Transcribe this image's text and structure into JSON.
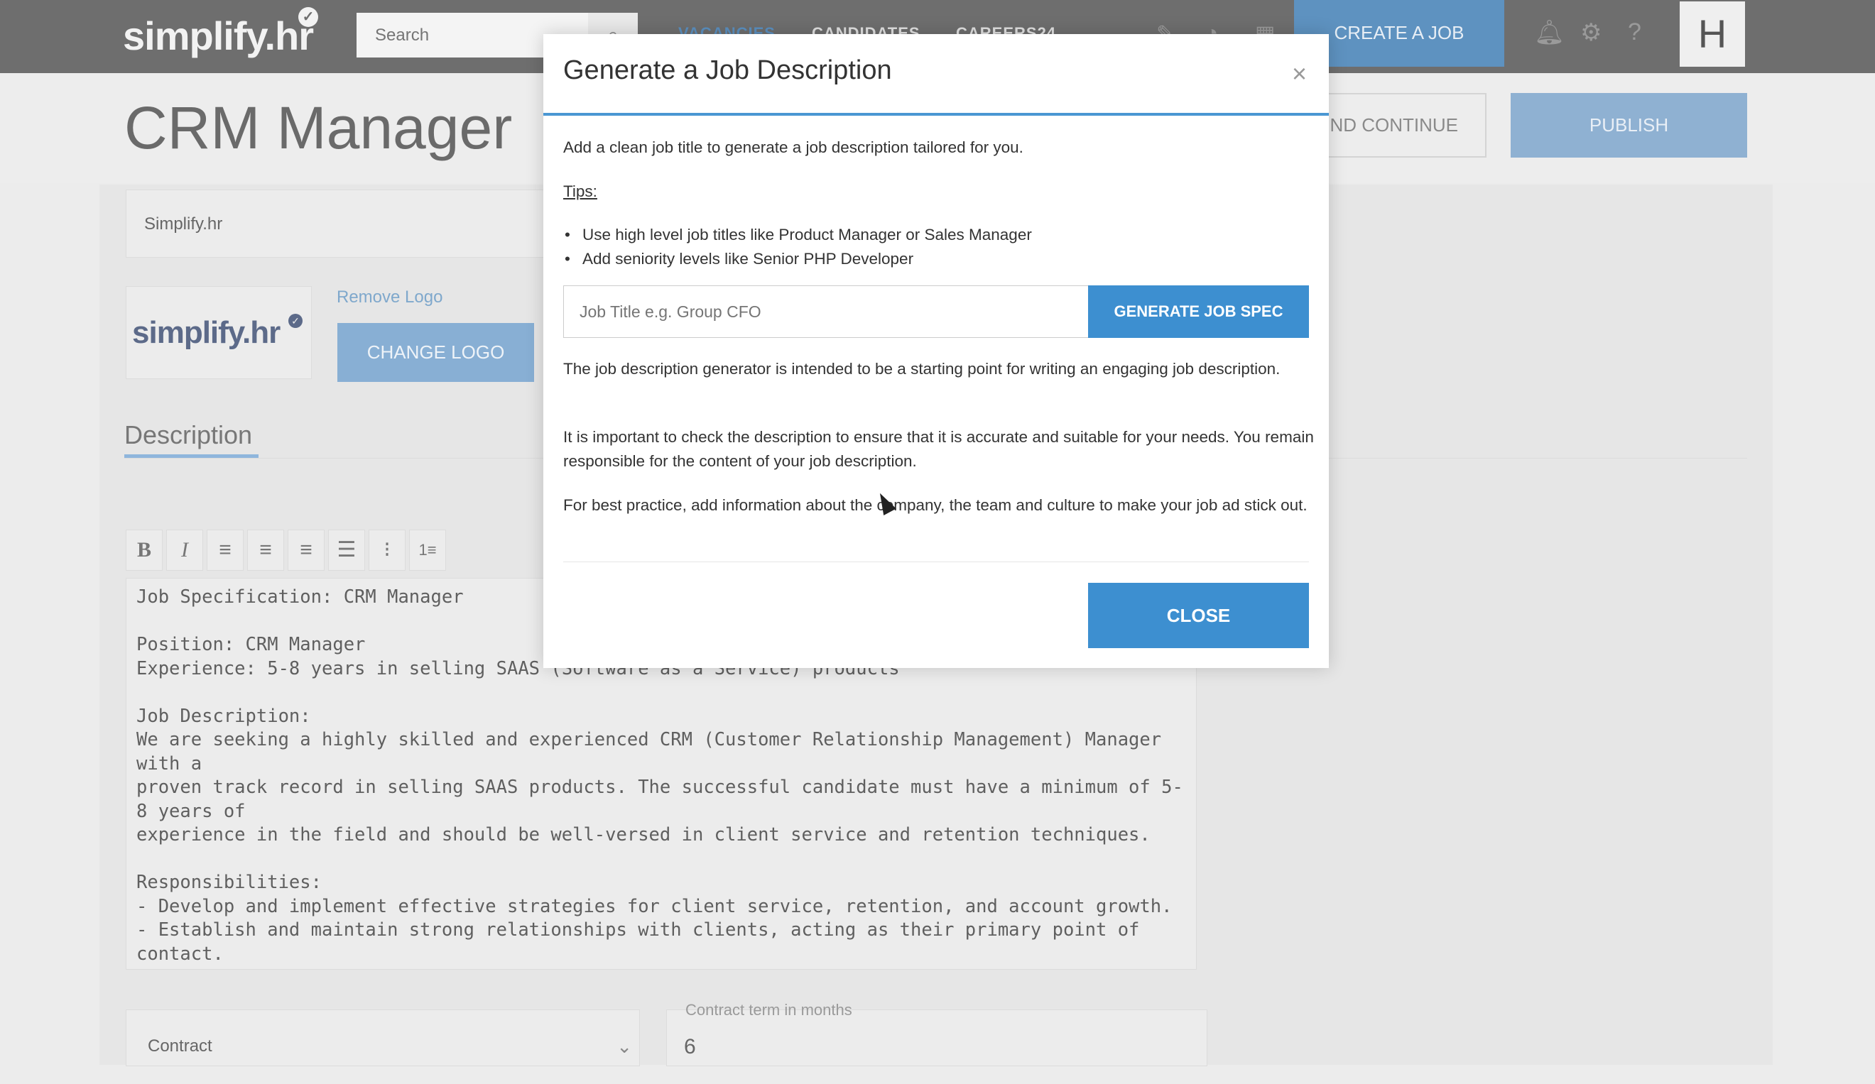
{
  "app": {
    "logo_text": "simplify.hr",
    "search_placeholder": "Search",
    "nav": [
      "VACANCIES",
      "CANDIDATES",
      "CAREERS24"
    ],
    "create_job": "CREATE A JOB",
    "avatar_initial": "H"
  },
  "page": {
    "title": "CRM Manager",
    "save_continue": "ND CONTINUE",
    "publish": "PUBLISH"
  },
  "form": {
    "company_name": "Simplify.hr",
    "logo_text": "simplify.hr",
    "remove_logo": "Remove Logo",
    "change_logo": "CHANGE LOGO",
    "description_tab": "Description",
    "description_text": "Job Specification: CRM Manager\n\nPosition: CRM Manager\nExperience: 5-8 years in selling SAAS (Software as a Service) products\n\nJob Description:\nWe are seeking a highly skilled and experienced CRM (Customer Relationship Management) Manager with a\nproven track record in selling SAAS products. The successful candidate must have a minimum of 5-8 years of\nexperience in the field and should be well-versed in client service and retention techniques.\n\nResponsibilities:\n- Develop and implement effective strategies for client service, retention, and account growth.\n- Establish and maintain strong relationships with clients, acting as their primary point of contact.\n- Analyze client needs and identify opportunities for upselling and cross-selling of SAAS products.\n- Collaborate with the sales team to generate new leads and expand the customer base.\n- Design and implement CRM processes and systems to improve efficiency and effectiveness.",
    "contract_type": "Contract",
    "contract_term_label": "Contract term in months",
    "contract_term_value": "6"
  },
  "modal": {
    "title": "Generate a Job Description",
    "close_x": "×",
    "intro": "Add a clean job title to generate a job description tailored for you.",
    "tips_heading": "Tips:",
    "tips": [
      "Use high level job titles like Product Manager or Sales Manager",
      "Add seniority levels like Senior PHP Developer"
    ],
    "input_placeholder": "Job Title e.g. Group CFO",
    "generate_button": "GENERATE JOB SPEC",
    "para1": "The job description generator is intended to be a starting point for writing an engaging job description.",
    "para2": "It is important to check the description to ensure that it is accurate and suitable for your needs. You remain responsible for the content of your job description.",
    "para3": "For best practice, add information about the company, the team and culture to make your job ad stick out.",
    "close_button": "CLOSE"
  },
  "colors": {
    "topbar": "#6e6e6e",
    "primary": "#3d8fd0",
    "accent_line": "#4a97d3"
  }
}
